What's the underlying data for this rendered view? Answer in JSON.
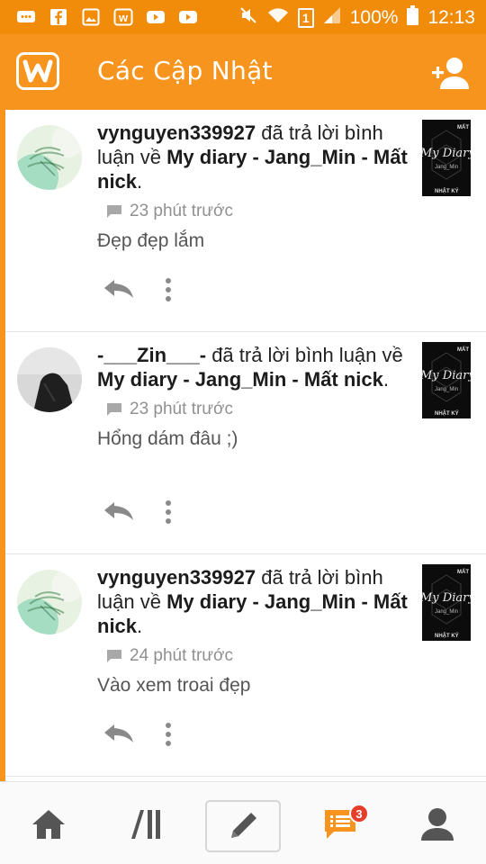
{
  "status_bar": {
    "battery_percent": "100%",
    "time": "12:13",
    "sim_label": "1",
    "icons": [
      "chat-bubble-icon",
      "facebook-icon",
      "gallery-icon",
      "wattpad-icon",
      "youtube-icon",
      "youtube-icon",
      "mute-icon",
      "wifi-icon",
      "sim-icon",
      "signal-icon",
      "battery-icon"
    ]
  },
  "header": {
    "title": "Các Cập Nhật",
    "logo_letter": "w"
  },
  "colors": {
    "brand_orange": "#f7941d",
    "status_orange": "#f08c0a",
    "badge_red": "#e53e2a",
    "meta_gray": "#909090"
  },
  "feed": {
    "items": [
      {
        "user": "vynguyen339927",
        "action": "đã trả lời bình luận về",
        "story": "My diary - Jang_Min - Mất nick",
        "time": "23 phút trước",
        "comment": "Đẹp đẹp lắm",
        "cover_title": "My Diary",
        "cover_sub": "Jang_Min",
        "cover_top": "MẤT",
        "cover_bottom": "NHẬT KÝ"
      },
      {
        "user": "-___Zin___-",
        "action": "đã trả lời bình luận về",
        "story": "My diary - Jang_Min - Mất nick",
        "time": "23 phút trước",
        "comment": "Hổng dám đâu ;)",
        "cover_title": "My Diary",
        "cover_sub": "Jang_Min",
        "cover_top": "MẤT",
        "cover_bottom": "NHẬT KÝ"
      },
      {
        "user": "vynguyen339927",
        "action": "đã trả lời bình luận về",
        "story": "My diary - Jang_Min - Mất nick",
        "time": "24 phút trước",
        "comment": "Vào xem troai đẹp",
        "cover_title": "My Diary",
        "cover_sub": "Jang_Min",
        "cover_top": "MẤT",
        "cover_bottom": "NHẬT KÝ"
      }
    ]
  },
  "bottom_nav": {
    "notifications_badge": "3",
    "items": [
      "home-icon",
      "library-icon",
      "write-icon",
      "notifications-icon",
      "profile-icon"
    ]
  }
}
